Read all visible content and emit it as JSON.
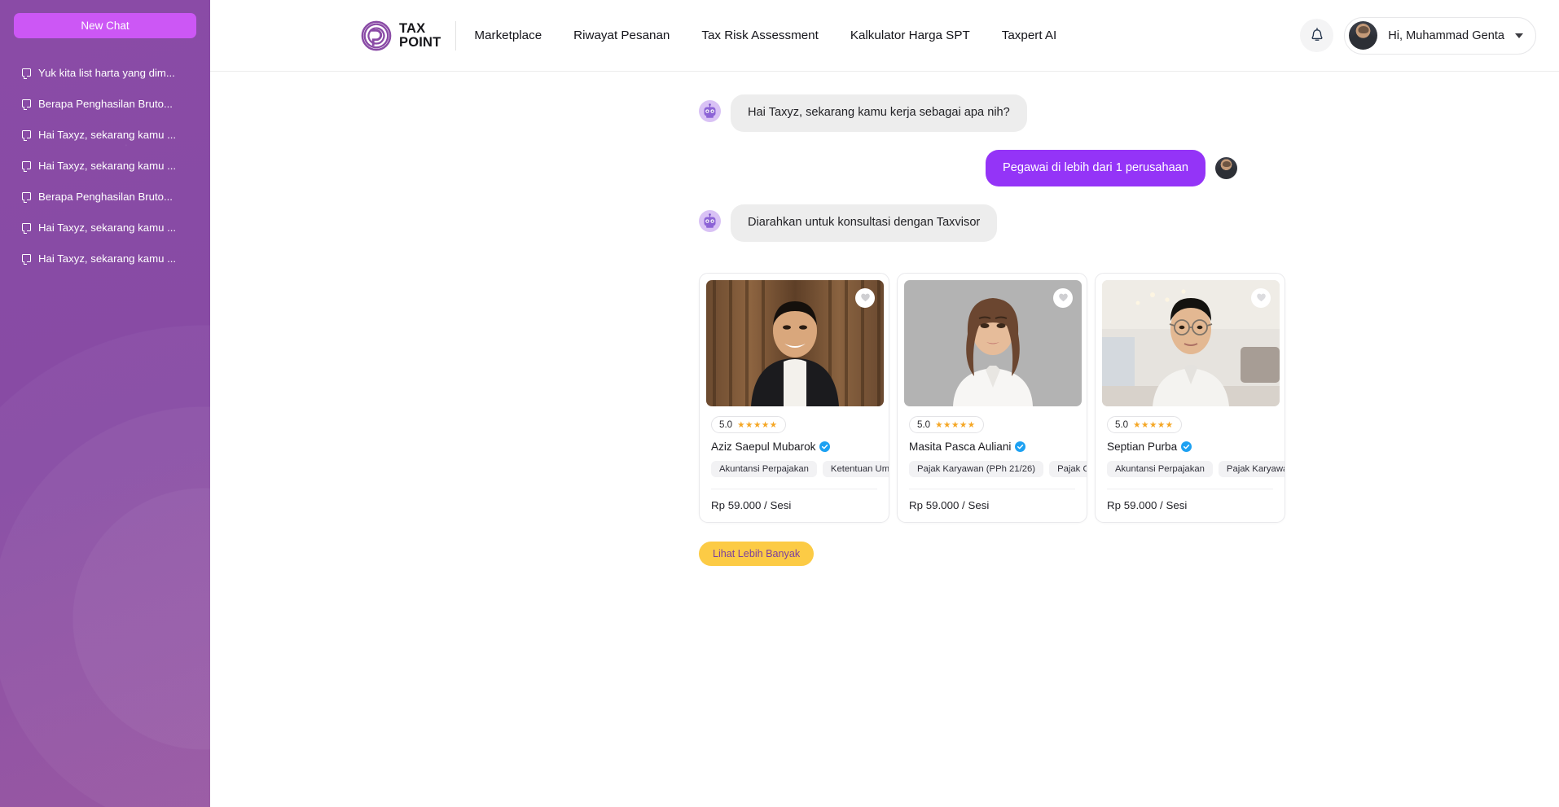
{
  "sidebar": {
    "new_chat_label": "New Chat",
    "items": [
      {
        "icon": "message-icon",
        "label": "Yuk kita list harta yang dim..."
      },
      {
        "icon": "message-icon",
        "label": "Berapa Penghasilan Bruto..."
      },
      {
        "icon": "message-icon",
        "label": "Hai Taxyz, sekarang kamu ..."
      },
      {
        "icon": "message-icon",
        "label": "Hai Taxyz, sekarang kamu ..."
      },
      {
        "icon": "message-icon",
        "label": "Berapa Penghasilan Bruto..."
      },
      {
        "icon": "message-icon",
        "label": "Hai Taxyz, sekarang kamu ..."
      },
      {
        "icon": "message-icon",
        "label": "Hai Taxyz, sekarang kamu ..."
      }
    ],
    "background_color": "#8A4BA6",
    "new_chat_color": "#CC57F5"
  },
  "header": {
    "logo": {
      "icon": "taxpoint-spiral-logo",
      "line1": "TAX",
      "line2": "POINT"
    },
    "nav": [
      {
        "label": "Marketplace"
      },
      {
        "label": "Riwayat Pesanan"
      },
      {
        "label": "Tax Risk Assessment"
      },
      {
        "label": "Kalkulator Harga SPT"
      },
      {
        "label": "Taxpert AI"
      }
    ],
    "notification_icon": "bell-icon",
    "user": {
      "greeting": "Hi, Muhammad Genta",
      "avatar": "user-avatar",
      "caret": "chevron-down-icon"
    }
  },
  "chat": {
    "messages": [
      {
        "from": "bot",
        "avatar": "robot-avatar",
        "text": "Hai Taxyz, sekarang kamu kerja sebagai apa nih?"
      },
      {
        "from": "user",
        "avatar": "user-avatar",
        "text": "Pegawai di lebih dari 1 perusahaan"
      },
      {
        "from": "bot",
        "avatar": "robot-avatar",
        "text": "Diarahkan untuk konsultasi dengan Taxvisor"
      }
    ],
    "bot_bubble_color": "#EDEDED",
    "user_bubble_color": "#9434F7"
  },
  "consultants": [
    {
      "photo": "consultant-photo-male-suit",
      "favorite_icon": "heart-icon",
      "rating": "5.0",
      "stars": "★★★★★",
      "name": "Aziz Saepul Mubarok",
      "verified_icon": "verified-badge-icon",
      "tags": [
        "Akuntansi Perpajakan",
        "Ketentuan Umum"
      ],
      "price": "Rp 59.000 / Sesi"
    },
    {
      "photo": "consultant-photo-female-white-shirt",
      "favorite_icon": "heart-icon",
      "rating": "5.0",
      "stars": "★★★★★",
      "name": "Masita Pasca Auliani",
      "verified_icon": "verified-badge-icon",
      "tags": [
        "Pajak Karyawan (PPh 21/26)",
        "Pajak Oran"
      ],
      "price": "Rp 59.000 / Sesi"
    },
    {
      "photo": "consultant-photo-male-glasses",
      "favorite_icon": "heart-icon",
      "rating": "5.0",
      "stars": "★★★★★",
      "name": "Septian Purba",
      "verified_icon": "verified-badge-icon",
      "tags": [
        "Akuntansi Perpajakan",
        "Pajak Karyawan ("
      ],
      "price": "Rp 59.000 / Sesi"
    }
  ],
  "more_button": {
    "label": "Lihat Lebih Banyak",
    "bg": "#FCCB45",
    "fg": "#7B3F9E"
  }
}
